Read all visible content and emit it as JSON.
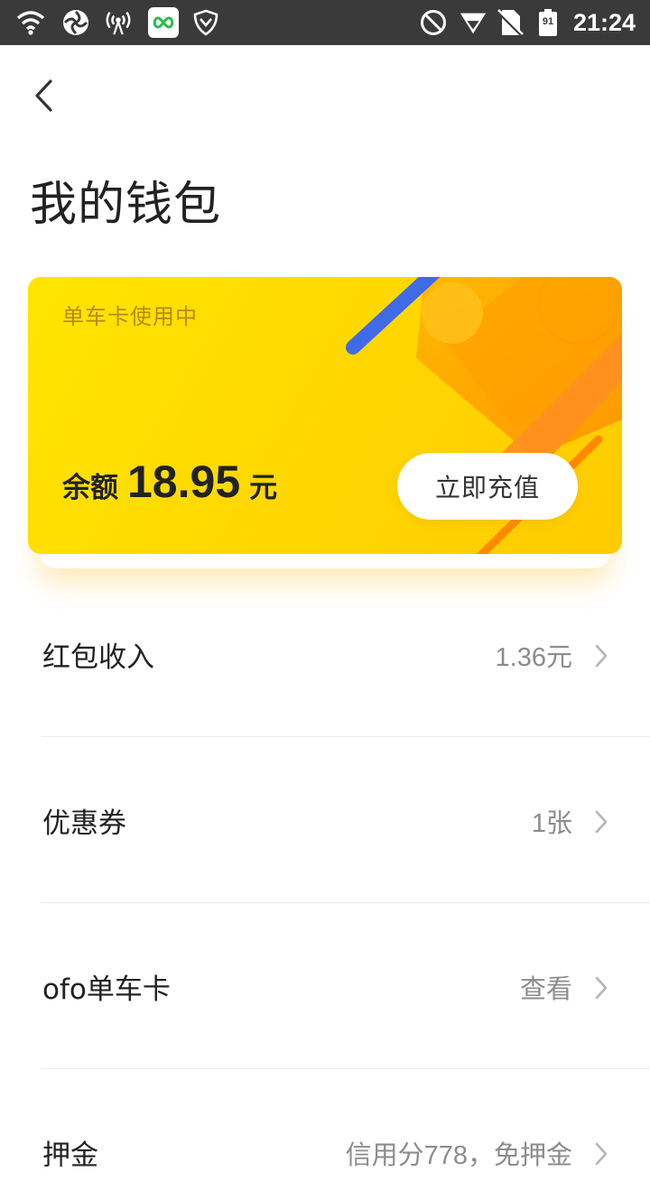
{
  "status_bar": {
    "time": "21:24",
    "battery_level": "91",
    "left_icons": [
      "wifi-icon",
      "vpn-icon",
      "hotspot-icon",
      "app-notification-icon",
      "shield-icon"
    ],
    "right_icons": [
      "do-not-disturb-icon",
      "signal-icon",
      "no-sim-icon",
      "battery-icon"
    ]
  },
  "header": {
    "title": "我的钱包"
  },
  "card": {
    "status": "单车卡使用中",
    "balance_label": "余额",
    "balance_value": "18.95",
    "balance_unit": "元",
    "recharge_label": "立即充值",
    "colors": {
      "card_yellow": "#ffe000",
      "accent_blue": "#3f6ae8",
      "accent_orange": "#ff8a00"
    }
  },
  "list": {
    "items": [
      {
        "label": "红包收入",
        "value": "1.36元"
      },
      {
        "label": "优惠券",
        "value": "1张"
      },
      {
        "label": "ofo单车卡",
        "value": "查看"
      },
      {
        "label": "押金",
        "value": "信用分778，免押金"
      }
    ]
  }
}
